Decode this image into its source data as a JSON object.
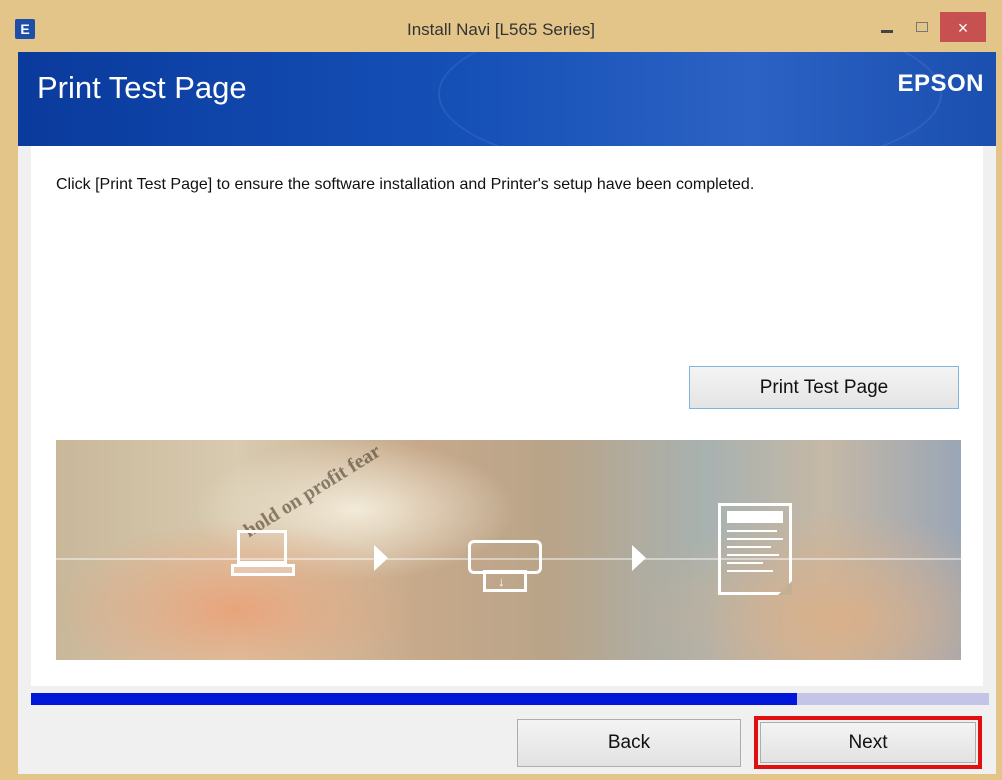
{
  "window": {
    "title": "Install Navi [L565 Series]",
    "app_icon_glyph": "E",
    "close_glyph": "×"
  },
  "header": {
    "page_title": "Print Test Page",
    "brand": "EPSON"
  },
  "content": {
    "instruction": "Click [Print Test Page] to ensure the software installation and Printer's setup have been completed.",
    "print_button_label": "Print Test Page"
  },
  "banner": {
    "icons": [
      "laptop-icon",
      "arrow-right-icon",
      "printer-icon",
      "arrow-right-icon",
      "printed-page-icon"
    ],
    "background_text": "hold on profit fear",
    "tray_glyph": "↓"
  },
  "progress": {
    "percent": 80
  },
  "footer": {
    "back_label": "Back",
    "next_label": "Next"
  },
  "colors": {
    "header_blue": "#1550b7",
    "progress_fill": "#0016d8",
    "highlight_red": "#e01010",
    "close_button": "#c75050",
    "frame": "#e3c58a"
  }
}
